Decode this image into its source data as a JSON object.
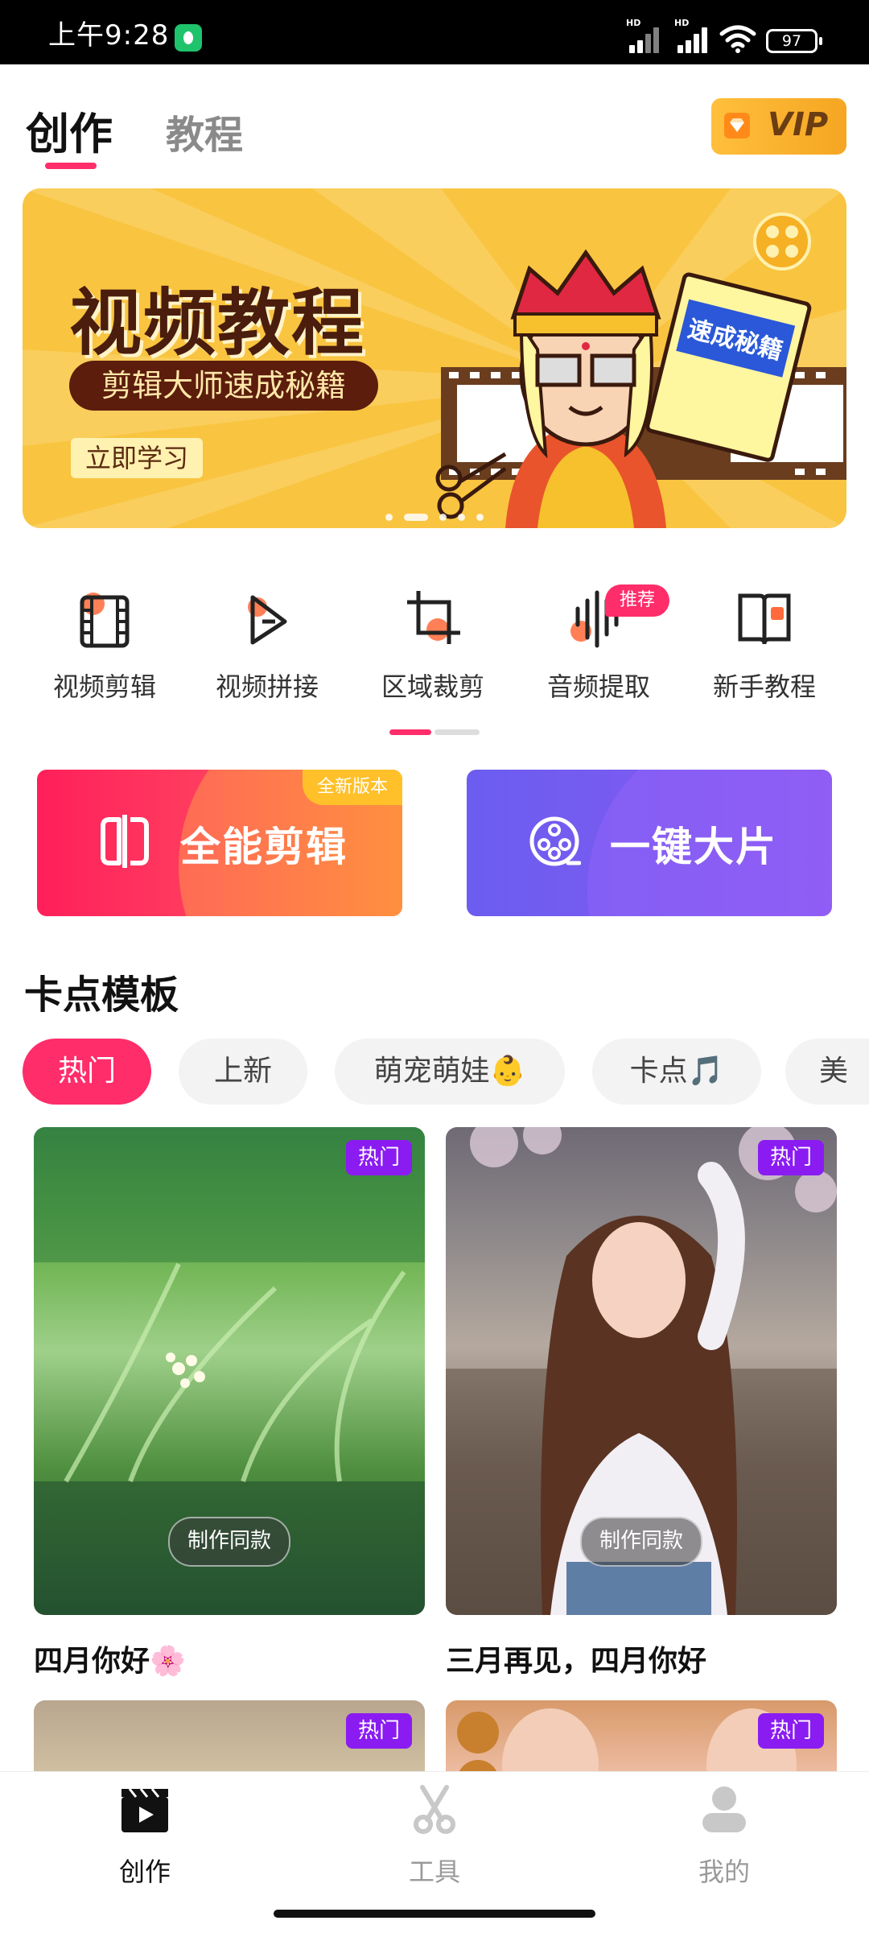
{
  "status_bar": {
    "time": "上午9:28",
    "signal1": "HD",
    "signal2": "HD",
    "battery": "97"
  },
  "header": {
    "tabs": [
      "创作",
      "教程"
    ],
    "active_tab": "创作",
    "vip_label": "VIP"
  },
  "banner": {
    "title": "视频教程",
    "subtitle": "剪辑大师速成秘籍",
    "cta": "立即学习",
    "book_text": "速成秘籍",
    "page_count": 5,
    "active_page": 2
  },
  "tools": {
    "items": [
      {
        "label": "视频剪辑",
        "icon": "film-icon"
      },
      {
        "label": "视频拼接",
        "icon": "merge-play-icon"
      },
      {
        "label": "区域裁剪",
        "icon": "crop-icon"
      },
      {
        "label": "音频提取",
        "icon": "audio-wave-icon"
      },
      {
        "label": "新手教程",
        "icon": "book-icon"
      }
    ],
    "badge": "推荐"
  },
  "cards": {
    "edit": {
      "label": "全能剪辑",
      "tag": "全新版本",
      "icon": "split-frame-icon"
    },
    "film": {
      "label": "一键大片",
      "icon": "film-reel-icon"
    }
  },
  "templates": {
    "section_title": "卡点模板",
    "chips": [
      "热门",
      "上新",
      "萌宠萌娃👶",
      "卡点🎵",
      "美"
    ],
    "active_chip": "热门",
    "hot_label": "热门",
    "make_same": "制作同款",
    "items": [
      {
        "title": "四月你好🌸"
      },
      {
        "title": "三月再见，四月你好"
      }
    ]
  },
  "bottom_nav": {
    "items": [
      {
        "label": "创作",
        "icon": "clapper-icon"
      },
      {
        "label": "工具",
        "icon": "scissors-icon"
      },
      {
        "label": "我的",
        "icon": "user-icon"
      }
    ],
    "active": "创作"
  },
  "colors": {
    "accent": "#ff2d6a",
    "vip": "#f5a622",
    "banner_bg": "#f9c440",
    "film_card": "#6b5df0",
    "hot_badge": "#8a1cf2"
  }
}
